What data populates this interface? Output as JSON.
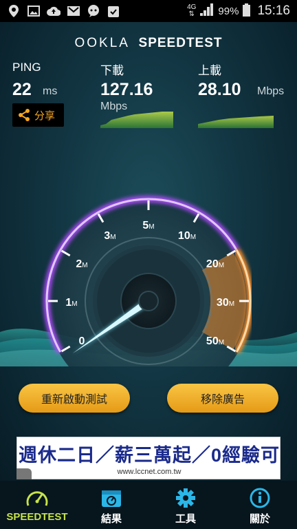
{
  "status_bar": {
    "network": "4G",
    "battery": "99%",
    "time": "15:16",
    "icons": [
      "location-icon",
      "image-icon",
      "cloud-upload-icon",
      "gmail-icon",
      "chat-icon",
      "clipboard-check-icon"
    ]
  },
  "brand": {
    "logo": "OOKLA",
    "name": "SPEEDTEST"
  },
  "ping": {
    "label": "PING",
    "value": "22",
    "unit": "ms"
  },
  "download": {
    "label": "下載",
    "value": "127.16",
    "unit": "Mbps"
  },
  "upload": {
    "label": "上載",
    "value": "28.10",
    "unit": "Mbps"
  },
  "share": {
    "label": "分享"
  },
  "gauge": {
    "ticks": [
      {
        "num": "0",
        "unit": ""
      },
      {
        "num": "1",
        "unit": "M"
      },
      {
        "num": "2",
        "unit": "M"
      },
      {
        "num": "3",
        "unit": "M"
      },
      {
        "num": "5",
        "unit": "M"
      },
      {
        "num": "10",
        "unit": "M"
      },
      {
        "num": "20",
        "unit": "M"
      },
      {
        "num": "30",
        "unit": "M"
      },
      {
        "num": "50",
        "unit": "M"
      }
    ],
    "needle_fraction": 0.0,
    "accent_primary": "#b24cff",
    "accent_secondary": "#f08a2a"
  },
  "actions": {
    "restart": "重新啟動測試",
    "remove_ads": "移除廣告"
  },
  "ad": {
    "title": "週休二日／薪三萬起／0經驗可",
    "url": "www.lccnet.com.tw"
  },
  "nav": [
    {
      "label": "SPEEDTEST",
      "icon": "speedometer-icon",
      "active": true
    },
    {
      "label": "結果",
      "icon": "results-box-icon",
      "active": false
    },
    {
      "label": "工具",
      "icon": "gear-icon",
      "active": false
    },
    {
      "label": "關於",
      "icon": "info-icon",
      "active": false
    }
  ],
  "colors": {
    "accent": "#c6e34a",
    "nav_icon": "#2bb6e8",
    "button": "#f5b731"
  }
}
